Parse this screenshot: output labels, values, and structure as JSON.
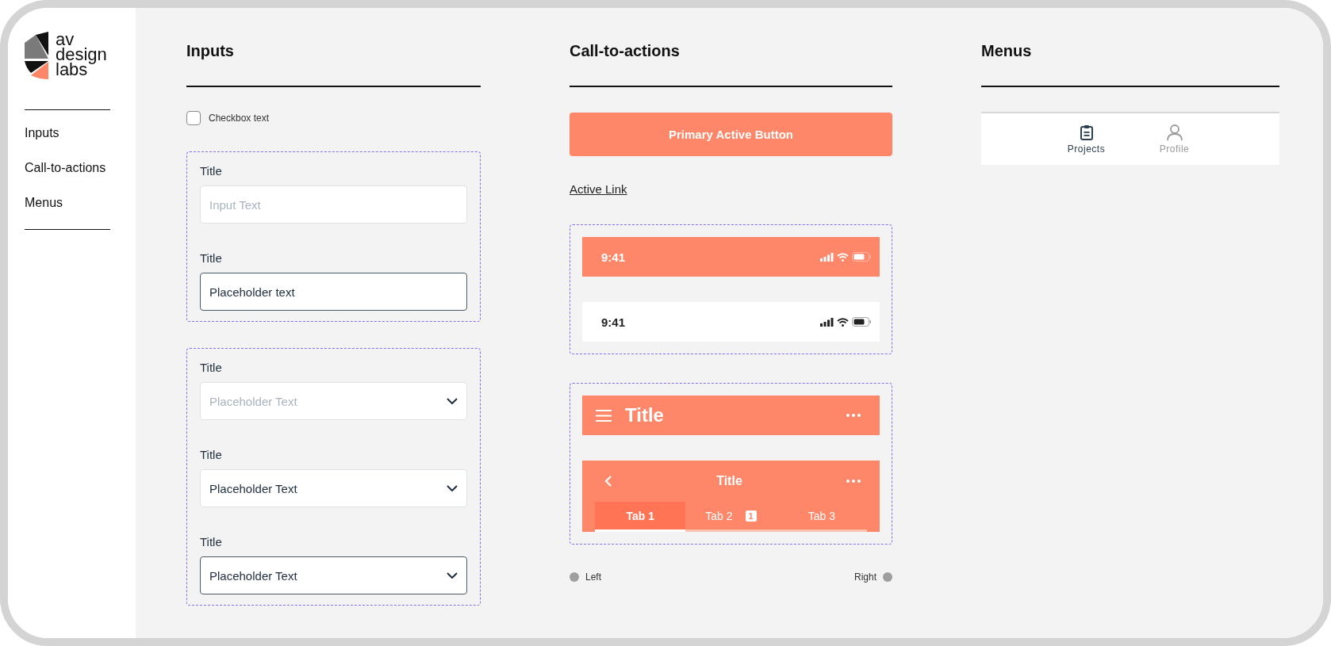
{
  "sidebar": {
    "logo_text": "av design labs",
    "nav_items": [
      "Inputs",
      "Call-to-actions",
      "Menus"
    ]
  },
  "inputs": {
    "heading": "Inputs",
    "checkbox": {
      "label": "Checkbox text",
      "checked": false
    },
    "text_fields": [
      {
        "label": "Title",
        "placeholder": "Input Text",
        "active": false
      },
      {
        "label": "Title",
        "value": "Placeholder text",
        "active": true
      }
    ],
    "dropdowns": [
      {
        "label": "Title",
        "placeholder": "Placeholder Text",
        "active": false
      },
      {
        "label": "Title",
        "value": "Placeholder Text",
        "active": false
      },
      {
        "label": "Title",
        "value": "Placeholder Text",
        "active": true
      }
    ]
  },
  "call_to_actions": {
    "heading": "Call-to-actions",
    "primary_button": "Primary Active Button",
    "link": "Active Link",
    "status_bars": [
      {
        "kind": "filled",
        "time": "9:41"
      },
      {
        "kind": "light",
        "time": "9:41"
      }
    ],
    "app_bars": [
      {
        "kind": "large",
        "title": "Title"
      },
      {
        "kind": "tabbed",
        "title": "Title",
        "tabs": [
          {
            "label": "Tab 1",
            "selected": true
          },
          {
            "label": "Tab 2",
            "selected": false,
            "badge": "1"
          },
          {
            "label": "Tab 3",
            "selected": false
          }
        ]
      }
    ],
    "alignment_labels": [
      "Left",
      "Right"
    ]
  },
  "menus": {
    "heading": "Menus",
    "bottom_nav": [
      {
        "label": "Projects",
        "kind": "clipboard",
        "selected": true
      },
      {
        "label": "Profile",
        "kind": "person",
        "selected": false
      }
    ]
  }
}
